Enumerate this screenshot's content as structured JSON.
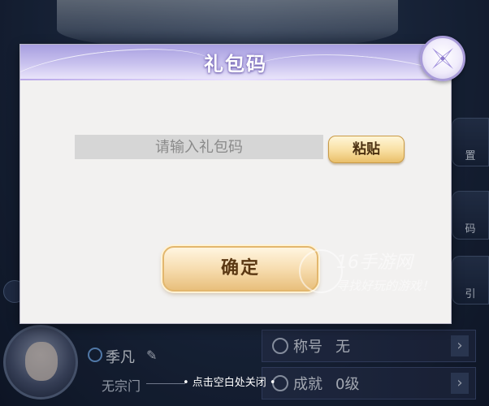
{
  "dialog": {
    "title": "礼包码",
    "input_placeholder": "请输入礼包码",
    "paste_label": "粘贴",
    "confirm_label": "确定",
    "close_icon": "close-x-icon"
  },
  "background": {
    "player_name": "季凡",
    "sect": "无宗门",
    "close_hint": "• 点击空白处关闭 •",
    "title_label": "称号",
    "title_value": "无",
    "achievement_label": "成就",
    "achievement_value": "0级",
    "side_buttons": [
      "置",
      "码",
      "引"
    ]
  },
  "watermark": {
    "line1": "16手游网",
    "line2": "寻找好玩的游戏！"
  },
  "colors": {
    "header": "#c8c1ee",
    "panel": "#f2f1f0",
    "button_gold": "#f7ddb0",
    "input_bg": "#d6d6d6"
  }
}
